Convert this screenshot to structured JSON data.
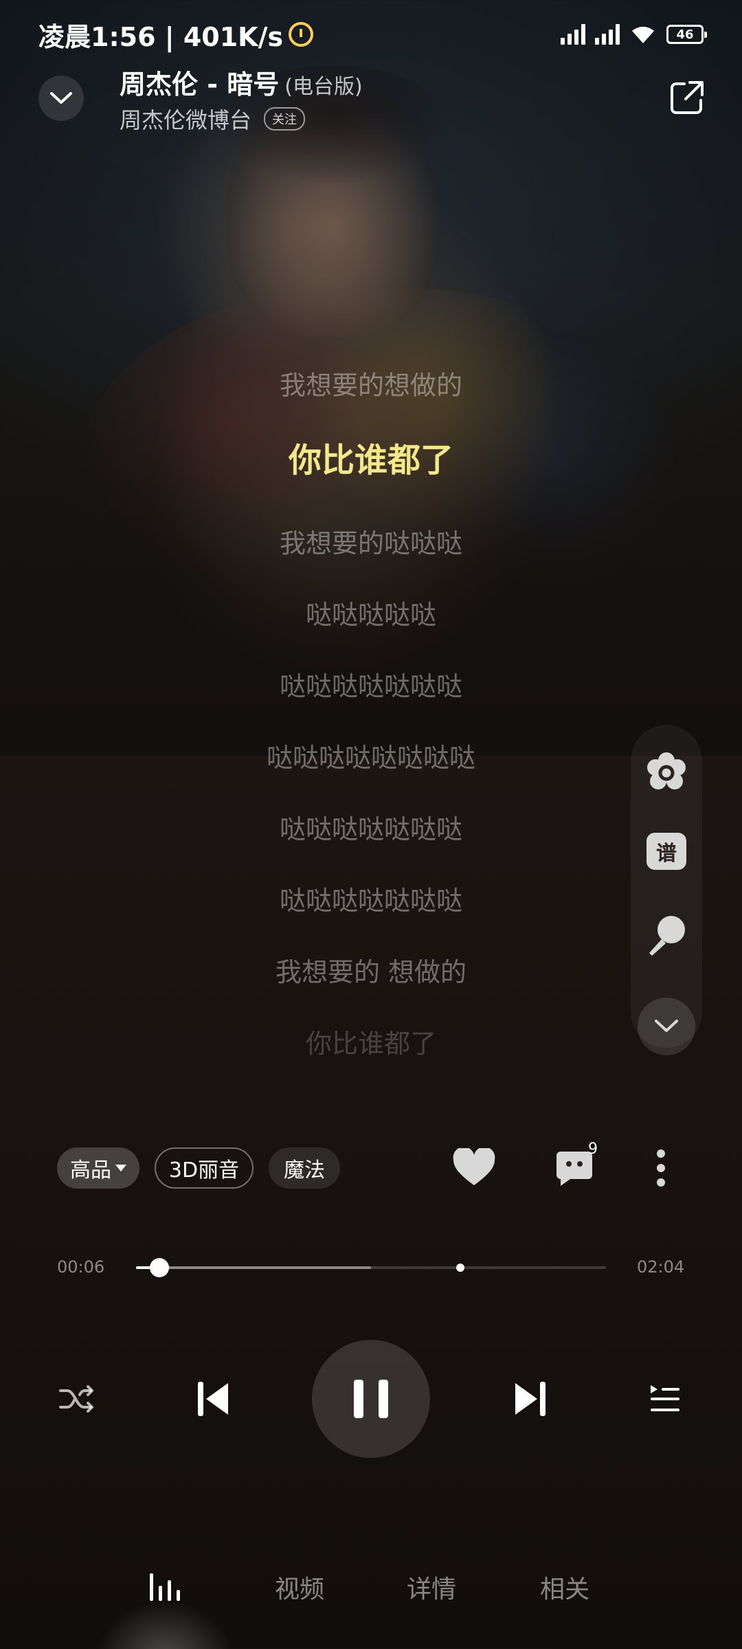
{
  "status_bar": {
    "time_speed": "凌晨1:56 | 401K/s",
    "battery": "46"
  },
  "header": {
    "title": "周杰伦 - 暗号",
    "version_tag": "(电台版)",
    "artist": "周杰伦微博台",
    "follow_label": "关注"
  },
  "lyrics": [
    "我想要的想做的",
    "你比谁都了",
    "我想要的哒哒哒",
    "哒哒哒哒哒",
    "哒哒哒哒哒哒哒",
    "哒哒哒哒哒哒哒哒",
    "哒哒哒哒哒哒哒",
    "哒哒哒哒哒哒哒",
    "我想要的 想做的",
    "你比谁都了"
  ],
  "current_lyric_index": 1,
  "side_tools": {
    "score_label": "谱"
  },
  "quality_row": {
    "quality_label": "高品",
    "spatial_label": "3D丽音",
    "magic_label": "魔法",
    "comment_count": "9"
  },
  "progress": {
    "elapsed": "00:06",
    "total": "02:04",
    "played_fraction": 0.05,
    "buffered_fraction": 0.5,
    "marker_fraction": 0.69
  },
  "tabs": {
    "video": "视频",
    "details": "详情",
    "related": "相关"
  },
  "colors": {
    "current_lyric": "#f3e98a",
    "alarm_icon": "#ffd050"
  }
}
